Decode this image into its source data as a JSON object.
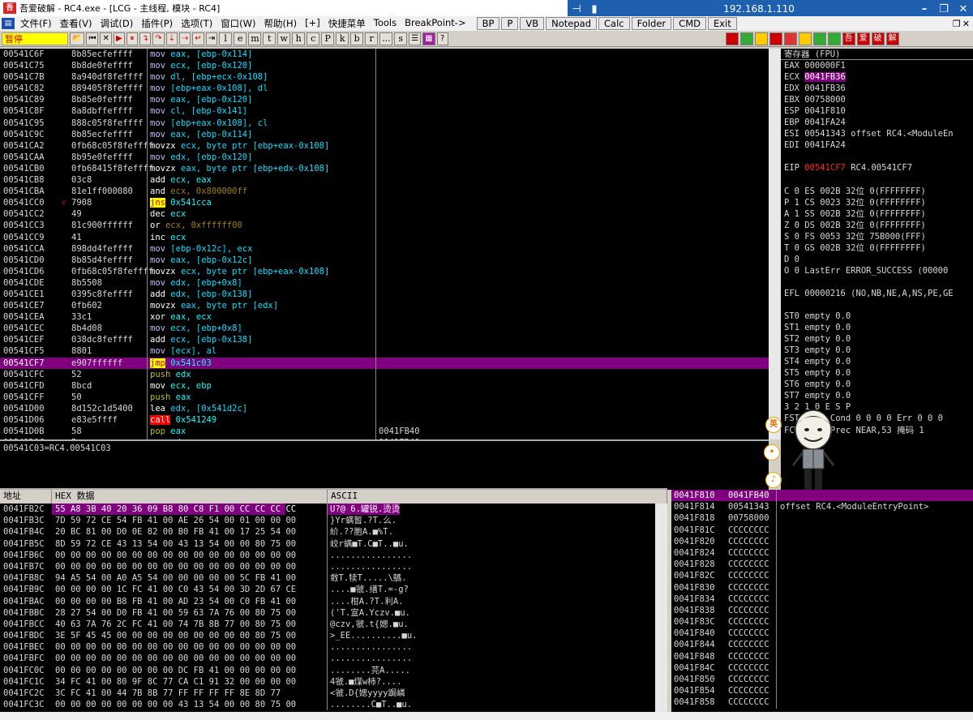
{
  "window": {
    "title": "吾爱破解 - RC4.exe - [LCG - 主线程, 模块 - RC4]"
  },
  "remote": {
    "ip": "192.168.1.110"
  },
  "menu": {
    "items": [
      "文件(F)",
      "查看(V)",
      "调试(D)",
      "插件(P)",
      "选项(T)",
      "窗口(W)",
      "帮助(H)",
      "[+]",
      "快捷菜单",
      "Tools",
      "BreakPoint->"
    ],
    "right_buttons": [
      "BP",
      "P",
      "VB",
      "Notepad",
      "Calc",
      "Folder",
      "CMD",
      "Exit"
    ]
  },
  "toolbar": {
    "status": "暂停",
    "letters": [
      "l",
      "e",
      "m",
      "t",
      "w",
      "h",
      "c",
      "P",
      "k",
      "b",
      "r",
      "...",
      "s"
    ]
  },
  "cpu": {
    "rows": [
      {
        "addr": "00541C6F",
        "jm": "",
        "hex": "8b85ecfeffff",
        "mn": "mov",
        "mc": "mov",
        "op": "eax, [ebp-0x114]",
        "oc": "stk",
        "cm": ""
      },
      {
        "addr": "00541C75",
        "jm": "",
        "hex": "8b8de0feffff",
        "mn": "mov",
        "mc": "mov",
        "op": "ecx, [ebp-0x120]",
        "oc": "stk",
        "cm": ""
      },
      {
        "addr": "00541C7B",
        "jm": "",
        "hex": "8a940df8feffff",
        "mn": "mov",
        "mc": "mov",
        "op": "dl, [ebp+ecx-0x108]",
        "oc": "stk",
        "cm": ""
      },
      {
        "addr": "00541C82",
        "jm": "",
        "hex": "889405f8feffff",
        "mn": "mov",
        "mc": "mov",
        "op": "[ebp+eax-0x108], dl",
        "oc": "stk",
        "cm": ""
      },
      {
        "addr": "00541C89",
        "jm": "",
        "hex": "8b85e0feffff",
        "mn": "mov",
        "mc": "mov",
        "op": "eax, [ebp-0x120]",
        "oc": "stk",
        "cm": ""
      },
      {
        "addr": "00541C8F",
        "jm": "",
        "hex": "8a8dbffeffff",
        "mn": "mov",
        "mc": "mov",
        "op": "cl, [ebp-0x141]",
        "oc": "stk",
        "cm": ""
      },
      {
        "addr": "00541C95",
        "jm": "",
        "hex": "888c05f8feffff",
        "mn": "mov",
        "mc": "mov",
        "op": "[ebp+eax-0x108], cl",
        "oc": "stk",
        "cm": ""
      },
      {
        "addr": "00541C9C",
        "jm": "",
        "hex": "8b85ecfeffff",
        "mn": "mov",
        "mc": "mov",
        "op": "eax, [ebp-0x114]",
        "oc": "stk",
        "cm": ""
      },
      {
        "addr": "00541CA2",
        "jm": "",
        "hex": "0fb68c05f8feffff",
        "mn": "movzx",
        "mc": "movzx",
        "op": "ecx, byte ptr [ebp+eax-0x108]",
        "oc": "stk",
        "cm": ""
      },
      {
        "addr": "00541CAA",
        "jm": "",
        "hex": "8b95e0feffff",
        "mn": "mov",
        "mc": "mov",
        "op": "edx, [ebp-0x120]",
        "oc": "stk",
        "cm": ""
      },
      {
        "addr": "00541CB0",
        "jm": "",
        "hex": "0fb68415f8feffff",
        "mn": "movzx",
        "mc": "movzx",
        "op": "eax, byte ptr [ebp+edx-0x108]",
        "oc": "stk",
        "cm": ""
      },
      {
        "addr": "00541CB8",
        "jm": "",
        "hex": "03c8",
        "mn": "add",
        "mc": "arith",
        "op": "ecx, eax",
        "oc": "",
        "cm": ""
      },
      {
        "addr": "00541CBA",
        "jm": "",
        "hex": "81e1ff000080",
        "mn": "and",
        "mc": "arith",
        "op": "ecx, 0x800000ff",
        "oc": "imm",
        "cm": ""
      },
      {
        "addr": "00541CC0",
        "jm": "v",
        "hex": "7908",
        "mn": "jns",
        "mc": "jmp",
        "op": "0x541cca",
        "oc": "",
        "cm": ""
      },
      {
        "addr": "00541CC2",
        "jm": "",
        "hex": "49",
        "mn": "dec",
        "mc": "arith",
        "op": "ecx",
        "oc": "",
        "cm": ""
      },
      {
        "addr": "00541CC3",
        "jm": "",
        "hex": "81c900ffffff",
        "mn": "or",
        "mc": "arith",
        "op": "ecx, 0xffffff00",
        "oc": "imm",
        "cm": ""
      },
      {
        "addr": "00541CC9",
        "jm": "",
        "hex": "41",
        "mn": "inc",
        "mc": "arith",
        "op": "ecx",
        "oc": "",
        "cm": ""
      },
      {
        "addr": "00541CCA",
        "jm": "",
        "hex": "898dd4feffff",
        "mn": "mov",
        "mc": "mov",
        "op": "[ebp-0x12c], ecx",
        "oc": "stk",
        "cm": ""
      },
      {
        "addr": "00541CD0",
        "jm": "",
        "hex": "8b85d4feffff",
        "mn": "mov",
        "mc": "mov",
        "op": "eax, [ebp-0x12c]",
        "oc": "stk",
        "cm": ""
      },
      {
        "addr": "00541CD6",
        "jm": "",
        "hex": "0fb68c05f8feffff",
        "mn": "movzx",
        "mc": "movzx",
        "op": "ecx, byte ptr [ebp+eax-0x108]",
        "oc": "stk",
        "cm": ""
      },
      {
        "addr": "00541CDE",
        "jm": "",
        "hex": "8b5508",
        "mn": "mov",
        "mc": "mov",
        "op": "edx, [ebp+0x8]",
        "oc": "stk",
        "cm": ""
      },
      {
        "addr": "00541CE1",
        "jm": "",
        "hex": "0395c8feffff",
        "mn": "add",
        "mc": "arith",
        "op": "edx, [ebp-0x138]",
        "oc": "stk",
        "cm": ""
      },
      {
        "addr": "00541CE7",
        "jm": "",
        "hex": "0fb602",
        "mn": "movzx",
        "mc": "movzx",
        "op": "eax, byte ptr [edx]",
        "oc": "stk",
        "cm": ""
      },
      {
        "addr": "00541CEA",
        "jm": "",
        "hex": "33c1",
        "mn": "xor",
        "mc": "arith",
        "op": "eax, ecx",
        "oc": "",
        "cm": ""
      },
      {
        "addr": "00541CEC",
        "jm": "",
        "hex": "8b4d08",
        "mn": "mov",
        "mc": "mov",
        "op": "ecx, [ebp+0x8]",
        "oc": "stk",
        "cm": ""
      },
      {
        "addr": "00541CEF",
        "jm": "",
        "hex": "038dc8feffff",
        "mn": "add",
        "mc": "arith",
        "op": "ecx, [ebp-0x138]",
        "oc": "stk",
        "cm": ""
      },
      {
        "addr": "00541CF5",
        "jm": "",
        "hex": "8801",
        "mn": "mov",
        "mc": "mov",
        "op": "[ecx], al",
        "oc": "stk",
        "cm": ""
      },
      {
        "addr": "00541CF7",
        "jm": "^",
        "hex": "e907ffffff",
        "mn": "jmp",
        "mc": "jmp",
        "op": "0x541c03",
        "oc": "",
        "cm": "",
        "sel": true
      },
      {
        "addr": "00541CFC",
        "jm": "",
        "hex": "52",
        "mn": "push",
        "mc": "push",
        "op": "edx",
        "oc": "",
        "cm": ""
      },
      {
        "addr": "00541CFD",
        "jm": "",
        "hex": "8bcd",
        "mn": "mov",
        "mc": "arith",
        "op": "ecx, ebp",
        "oc": "",
        "cm": ""
      },
      {
        "addr": "00541CFF",
        "jm": "",
        "hex": "50",
        "mn": "push",
        "mc": "push",
        "op": "eax",
        "oc": "",
        "cm": ""
      },
      {
        "addr": "00541D00",
        "jm": "",
        "hex": "8d152c1d5400",
        "mn": "lea",
        "mc": "arith",
        "op": "edx, [0x541d2c]",
        "oc": "stk",
        "cm": ""
      },
      {
        "addr": "00541D06",
        "jm": "",
        "hex": "e83e5ffff",
        "mn": "call",
        "mc": "call",
        "op": "0x541249",
        "oc": "",
        "cm": ""
      },
      {
        "addr": "00541D0B",
        "jm": "",
        "hex": "58",
        "mn": "pop",
        "mc": "push",
        "op": "eax",
        "oc": "",
        "cm": "0041FB40"
      },
      {
        "addr": "00541D0C",
        "jm": "",
        "hex": "5a",
        "mn": "pop",
        "mc": "push",
        "op": "edx",
        "oc": "",
        "cm": "0041FB40"
      }
    ]
  },
  "info": {
    "text": "00541C03=RC4.00541C03"
  },
  "regs": {
    "header": "寄存器 (FPU)",
    "lines": [
      {
        "t": "EAX 000000F1"
      },
      {
        "t": "ECX ",
        "hl": "0041FB36"
      },
      {
        "t": "EDX 0041FB36"
      },
      {
        "t": "EBX 00758000"
      },
      {
        "t": "ESP 0041F810"
      },
      {
        "t": "EBP 0041FA24"
      },
      {
        "t": "ESI 00541343 offset RC4.<ModuleEn"
      },
      {
        "t": "EDI 0041FA24"
      },
      {
        "t": ""
      },
      {
        "t": "EIP ",
        "red": "00541CF7",
        "rest": " RC4.00541CF7"
      },
      {
        "t": ""
      },
      {
        "t": "C 0  ES 002B 32位 0(FFFFFFFF)"
      },
      {
        "t": "P 1  CS 0023 32位 0(FFFFFFFF)"
      },
      {
        "t": "A 1  SS 002B 32位 0(FFFFFFFF)"
      },
      {
        "t": "Z 0  DS 002B 32位 0(FFFFFFFF)"
      },
      {
        "t": "S 0  FS 0053 32位 75B000(FFF)"
      },
      {
        "t": "T 0  GS 002B 32位 0(FFFFFFFF)"
      },
      {
        "t": "D 0"
      },
      {
        "t": "O 0  LastErr ERROR_SUCCESS (00000"
      },
      {
        "t": ""
      },
      {
        "t": "EFL 00000216 (NO,NB,NE,A,NS,PE,GE"
      },
      {
        "t": ""
      },
      {
        "t": "ST0 empty 0.0"
      },
      {
        "t": "ST1 empty 0.0"
      },
      {
        "t": "ST2 empty 0.0"
      },
      {
        "t": "ST3 empty 0.0"
      },
      {
        "t": "ST4 empty 0.0"
      },
      {
        "t": "ST5 empty 0.0"
      },
      {
        "t": "ST6 empty 0.0"
      },
      {
        "t": "ST7 empty 0.0"
      },
      {
        "t": "              3 2 1 0      E S P"
      },
      {
        "t": "FST 0000  Cond 0 0 0 0  Err 0 0 0"
      },
      {
        "t": "FCW 027F  Prec NEAR,53  掩码    1"
      }
    ]
  },
  "dump": {
    "headers": [
      "地址",
      "HEX 数据",
      "ASCII"
    ],
    "rows": [
      {
        "a": "0041FB2C",
        "x": "55 A8 3B 40 20 36 09 B8 80 C8 F1 00 CC CC CC CC",
        "c": "U?@ 6.罐锐.烫烫"
      },
      {
        "a": "0041FB3C",
        "x": "7D 59 72 CE 54 FB 41 00 AE 26 54 00 01 00 00 00",
        "c": "}Yr螨暂.?T.么."
      },
      {
        "a": "0041FB4C",
        "x": "20 BC 81 00 D0 0E 82 00 B0 FB 41 00 17 25 54 00",
        "c": " 紒.??胞A.■%T."
      },
      {
        "a": "0041FB5C",
        "x": "8D 59 72 CE 43 13 54 00 43 13 54 00 00 80 75 00",
        "c": "峧r螨■T.C■T..■u."
      },
      {
        "a": "0041FB6C",
        "x": "00 00 00 00 00 00 00 00 00 00 00 00 00 00 00 00",
        "c": "................"
      },
      {
        "a": "0041FB7C",
        "x": "00 00 00 00 00 00 00 00 00 00 00 00 00 00 00 00",
        "c": "................"
      },
      {
        "a": "0041FB8C",
        "x": "94 A5 54 00 A0 A5 54 00 00 00 00 00 5C FB 41 00",
        "c": "敹T.犊T.....\\鷌."
      },
      {
        "a": "0041FB9C",
        "x": "00 00 00 00 1C FC 41 00 C0 43 54 00 3D 2D 67 CE",
        "c": "....■虢.缮T.=-g?"
      },
      {
        "a": "0041FBAC",
        "x": "00 00 00 00 B8 FB 41 00 AD 23 54 00 C0 FB 41 00",
        "c": "....柑A.?T.利A."
      },
      {
        "a": "0041FBBC",
        "x": "28 27 54 00 D0 FB 41 00 59 63 7A 76 00 80 75 00",
        "c": "('T.宣A.Yczv.■u."
      },
      {
        "a": "0041FBCC",
        "x": "40 63 7A 76 2C FC 41 00 74 7B 8B 77 00 80 75 00",
        "c": "@czv,虢.t{媤.■u."
      },
      {
        "a": "0041FBDC",
        "x": "3E 5F 45 45 00 00 00 00 00 00 00 00 00 80 75 00",
        "c": ">_EE..........■u."
      },
      {
        "a": "0041FBEC",
        "x": "00 00 00 00 00 00 00 00 00 00 00 00 00 00 00 00",
        "c": "................"
      },
      {
        "a": "0041FBFC",
        "x": "00 00 00 00 00 00 00 00 00 00 00 00 00 00 00 00",
        "c": "................"
      },
      {
        "a": "0041FC0C",
        "x": "00 00 00 00 00 00 00 00 DC FB 41 00 00 00 00 00",
        "c": "........芫A....."
      },
      {
        "a": "0041FC1C",
        "x": "34 FC 41 00 80 9F 8C 77 CA C1 91 32 00 00 00 00",
        "c": "4虢.■煤w柿?...."
      },
      {
        "a": "0041FC2C",
        "x": "3C FC 41 00 44 7B 8B 77 FF FF FF FF 8E 8D 77",
        "c": "<虢.D{媤yyyy跼嶙"
      },
      {
        "a": "0041FC3C",
        "x": "00 00 00 00 00 00 00 00 43 13 54 00 00 80 75 00",
        "c": "........C■T..■u."
      }
    ]
  },
  "stack": {
    "rows": [
      {
        "a": "0041F810",
        "v": "0041FB40",
        "c": "",
        "top": true
      },
      {
        "a": "0041F814",
        "v": "00541343",
        "c": "offset RC4.<ModuleEntryPoint>"
      },
      {
        "a": "0041F818",
        "v": "00758000",
        "c": ""
      },
      {
        "a": "0041F81C",
        "v": "CCCCCCCC",
        "c": ""
      },
      {
        "a": "0041F820",
        "v": "CCCCCCCC",
        "c": ""
      },
      {
        "a": "0041F824",
        "v": "CCCCCCCC",
        "c": ""
      },
      {
        "a": "0041F828",
        "v": "CCCCCCCC",
        "c": ""
      },
      {
        "a": "0041F82C",
        "v": "CCCCCCCC",
        "c": ""
      },
      {
        "a": "0041F830",
        "v": "CCCCCCCC",
        "c": ""
      },
      {
        "a": "0041F834",
        "v": "CCCCCCCC",
        "c": ""
      },
      {
        "a": "0041F838",
        "v": "CCCCCCCC",
        "c": ""
      },
      {
        "a": "0041F83C",
        "v": "CCCCCCCC",
        "c": ""
      },
      {
        "a": "0041F840",
        "v": "CCCCCCCC",
        "c": ""
      },
      {
        "a": "0041F844",
        "v": "CCCCCCCC",
        "c": ""
      },
      {
        "a": "0041F848",
        "v": "CCCCCCCC",
        "c": ""
      },
      {
        "a": "0041F84C",
        "v": "CCCCCCCC",
        "c": ""
      },
      {
        "a": "0041F850",
        "v": "CCCCCCCC",
        "c": ""
      },
      {
        "a": "0041F854",
        "v": "CCCCCCCC",
        "c": ""
      },
      {
        "a": "0041F858",
        "v": "CCCCCCCC",
        "c": ""
      }
    ]
  }
}
